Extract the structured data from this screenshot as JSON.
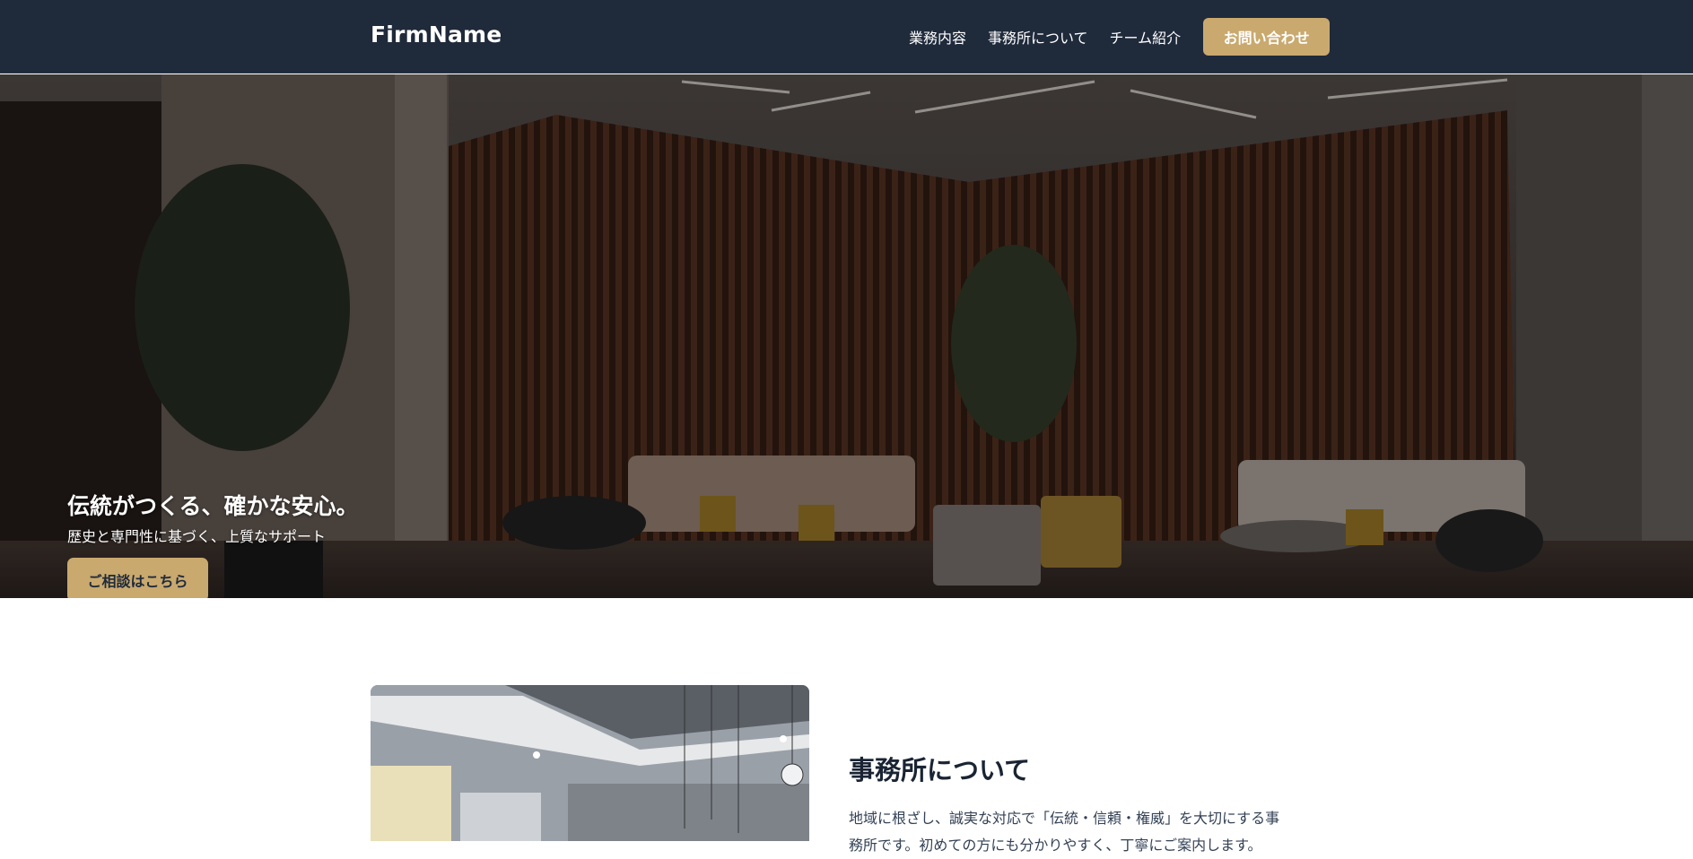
{
  "header": {
    "brand": "FirmName",
    "nav": [
      "業務内容",
      "事務所について",
      "チーム紹介"
    ],
    "cta_label": "お問い合わせ"
  },
  "hero": {
    "title": "伝統がつくる、確かな安心。",
    "subtitle": "歴史と専門性に基づく、上質なサポート",
    "button_label": "ご相談はこちら"
  },
  "about": {
    "title": "事務所について",
    "text": "地域に根ざし、誠実な対応で「伝統・信頼・権威」を大切にする事務所です。初めての方にも分かりやすく、丁寧にご案内します。"
  },
  "colors": {
    "header_bg": "#1f2a3b",
    "accent": "#c9a96e"
  }
}
